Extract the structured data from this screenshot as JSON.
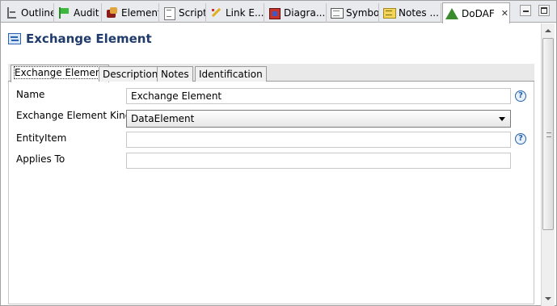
{
  "view_tabs": [
    {
      "label": "Outline",
      "icon": "outline-icon"
    },
    {
      "label": "Audit",
      "icon": "audit-flag-icon"
    },
    {
      "label": "Element",
      "icon": "element-icon"
    },
    {
      "label": "Script",
      "icon": "script-icon"
    },
    {
      "label": "Link E...",
      "icon": "link-icon"
    },
    {
      "label": "Diagra...",
      "icon": "diagram-icon"
    },
    {
      "label": "Symbol",
      "icon": "symbol-icon"
    },
    {
      "label": "Notes ...",
      "icon": "notes-icon"
    },
    {
      "label": "DoDAF",
      "icon": "dodaf-icon",
      "active": true,
      "close": "✕"
    }
  ],
  "window_controls": {
    "minimize": "minimize",
    "maximize": "maximize"
  },
  "header": {
    "title": "Exchange Element",
    "icon": "exchange-element-icon",
    "title_color": "#1f3b6b"
  },
  "page_tabs": [
    {
      "label": "Exchange Element",
      "active": true
    },
    {
      "label": "Description"
    },
    {
      "label": "Notes"
    },
    {
      "label": "Identification"
    }
  ],
  "form": {
    "name": {
      "label": "Name",
      "value": "Exchange Element",
      "help": "?"
    },
    "kind": {
      "label": "Exchange Element Kind",
      "value": "DataElement"
    },
    "entity_item": {
      "label": "EntityItem",
      "value": "",
      "help": "?"
    },
    "applies_to": {
      "label": "Applies To",
      "value": ""
    }
  },
  "colors": {
    "help_icon": "#2563a8",
    "tab_strip": "#e8eaee"
  }
}
